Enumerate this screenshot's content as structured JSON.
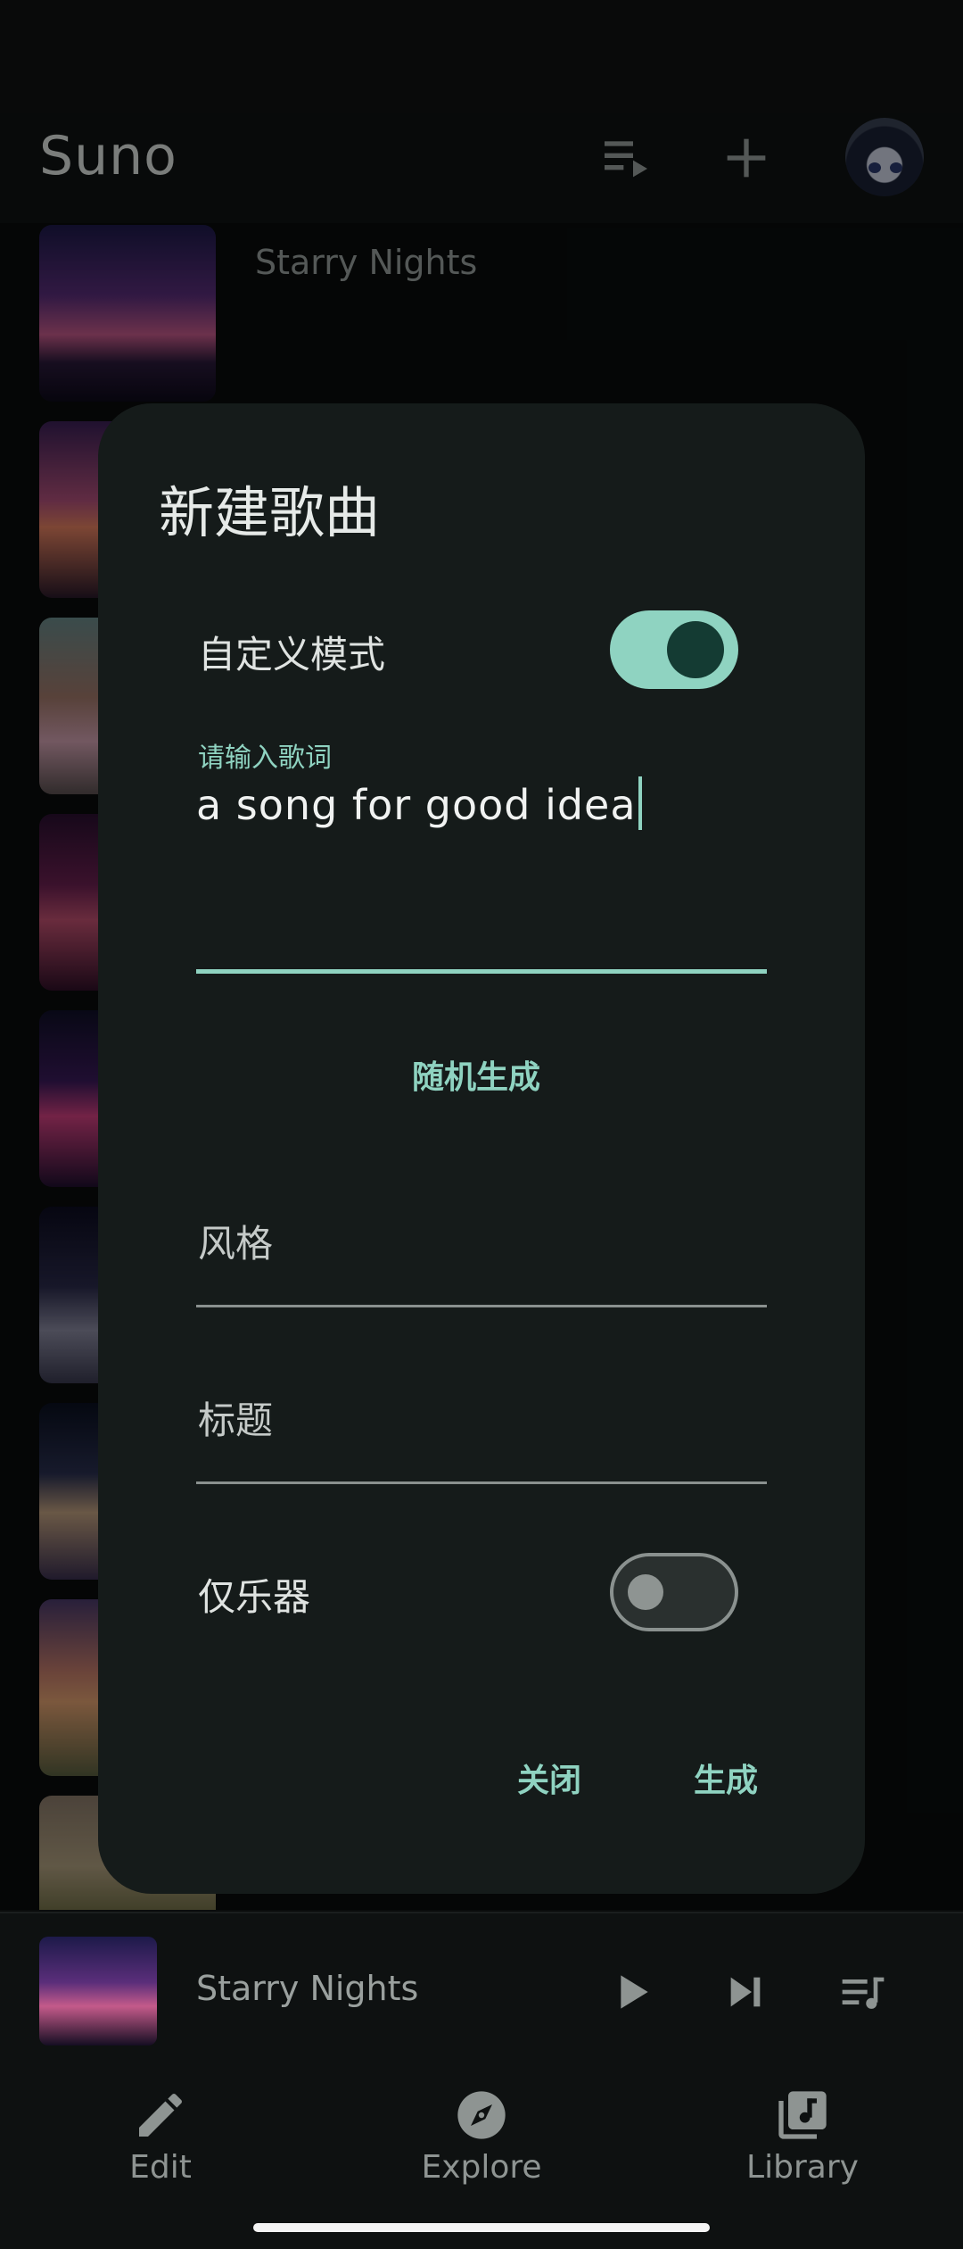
{
  "app": {
    "title": "Suno",
    "header_icons": [
      "queue-music-icon",
      "add-icon",
      "avatar"
    ]
  },
  "library": {
    "items": [
      {
        "title": "Starry Nights"
      }
    ]
  },
  "dialog": {
    "title": "新建歌曲",
    "custom_mode_label": "自定义模式",
    "custom_mode_on": true,
    "lyrics_label": "请输入歌词",
    "lyrics_value": "a song for good idea",
    "random_button": "随机生成",
    "style_placeholder": "风格",
    "title_placeholder": "标题",
    "instrumental_label": "仅乐器",
    "instrumental_on": false,
    "close_button": "关闭",
    "generate_button": "生成"
  },
  "player": {
    "title": "Starry Nights",
    "icons": [
      "play-icon",
      "skip-next-icon",
      "queue-icon"
    ]
  },
  "nav": {
    "items": [
      {
        "label": "Edit",
        "icon": "edit-icon"
      },
      {
        "label": "Explore",
        "icon": "explore-icon"
      },
      {
        "label": "Library",
        "icon": "library-music-icon"
      }
    ]
  },
  "colors": {
    "accent": "#8fd3c1",
    "dialog_bg": "#151b1a",
    "screen_bg": "#0a0c0c"
  }
}
